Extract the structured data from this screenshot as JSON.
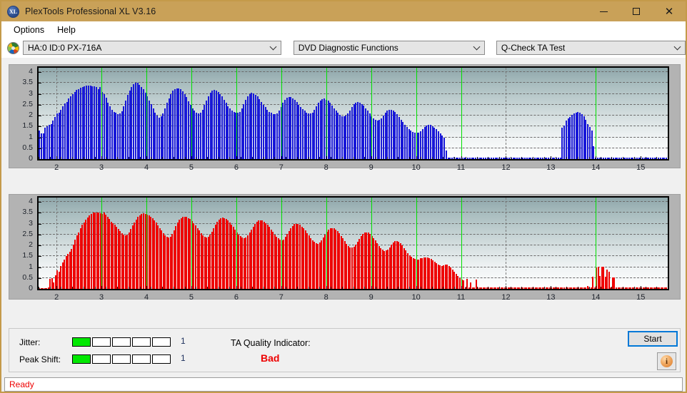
{
  "window": {
    "title": "PlexTools Professional XL V3.16",
    "icon": "XL",
    "minimize_label": "minimize",
    "maximize_label": "maximize",
    "close_label": "close"
  },
  "menu": {
    "items": [
      {
        "label": "Options"
      },
      {
        "label": "Help"
      }
    ]
  },
  "toolbar": {
    "drive": "HA:0 ID:0  PX-716A",
    "function": "DVD Diagnostic Functions",
    "test": "Q-Check TA Test"
  },
  "indicators": {
    "jitter_label": "Jitter:",
    "jitter_value": "1",
    "jitter_filled": 1,
    "jitter_segments": 5,
    "peakshift_label": "Peak Shift:",
    "peakshift_value": "1",
    "peakshift_filled": 1,
    "peakshift_segments": 5,
    "ta_label": "TA Quality Indicator:",
    "ta_value": "Bad",
    "ta_color": "#ee0000",
    "meter_on_color": "#00e800"
  },
  "buttons": {
    "start": "Start",
    "info": "i"
  },
  "status": {
    "text": "Ready"
  },
  "chart_data": [
    {
      "id": "ta-asymmetry-top",
      "type": "bar",
      "title": "",
      "xlabel": "",
      "ylabel": "",
      "color": "#1818d8",
      "ylim": [
        0,
        4.2
      ],
      "yticks": [
        0,
        0.5,
        1,
        1.5,
        2,
        2.5,
        3,
        3.5,
        4
      ],
      "ytick_labels": [
        "0",
        "0.5",
        "1",
        "1.5",
        "2",
        "2.5",
        "3",
        "3.5",
        "4"
      ],
      "xlim": [
        1.6,
        15.6
      ],
      "xticks": [
        2,
        3,
        4,
        5,
        6,
        7,
        8,
        9,
        10,
        11,
        12,
        13,
        14,
        15
      ],
      "xtick_labels": [
        "2",
        "3",
        "4",
        "5",
        "6",
        "7",
        "8",
        "9",
        "10",
        "11",
        "12",
        "13",
        "14",
        "15"
      ],
      "grid": true,
      "gridlines_v_dashed_at": [
        2,
        4,
        6,
        8,
        10,
        12,
        14
      ],
      "marker_lines_green_at": [
        3,
        4,
        5,
        6,
        7,
        8,
        9,
        10,
        11,
        14
      ],
      "marker_color": "#00e000",
      "values": [
        1.3,
        1.18,
        1.18,
        1.45,
        1.52,
        1.58,
        1.6,
        1.78,
        1.93,
        2.1,
        2.12,
        2.28,
        2.43,
        2.55,
        2.62,
        2.78,
        2.9,
        3.0,
        3.1,
        3.18,
        3.2,
        3.28,
        3.3,
        3.35,
        3.38,
        3.39,
        3.38,
        3.36,
        3.34,
        3.32,
        3.22,
        3.3,
        3.1,
        2.98,
        2.82,
        2.6,
        2.42,
        2.28,
        2.18,
        2.12,
        2.08,
        2.1,
        2.2,
        2.42,
        2.68,
        2.95,
        3.15,
        3.32,
        3.45,
        3.52,
        3.5,
        3.4,
        3.32,
        3.2,
        3.05,
        2.88,
        2.7,
        2.52,
        2.32,
        2.14,
        2.0,
        1.92,
        1.96,
        2.1,
        2.32,
        2.58,
        2.8,
        3.0,
        3.14,
        3.22,
        3.26,
        3.25,
        3.22,
        3.12,
        3.0,
        2.84,
        2.66,
        2.5,
        2.34,
        2.22,
        2.12,
        2.1,
        2.14,
        2.28,
        2.48,
        2.7,
        2.9,
        3.05,
        3.14,
        3.18,
        3.16,
        3.1,
        3.0,
        2.88,
        2.74,
        2.58,
        2.44,
        2.32,
        2.22,
        2.16,
        2.12,
        2.12,
        2.18,
        2.34,
        2.54,
        2.74,
        2.9,
        3.0,
        3.04,
        3.02,
        2.96,
        2.88,
        2.76,
        2.64,
        2.5,
        2.38,
        2.26,
        2.18,
        2.12,
        2.08,
        2.06,
        2.1,
        2.22,
        2.4,
        2.58,
        2.72,
        2.82,
        2.86,
        2.84,
        2.8,
        2.72,
        2.62,
        2.5,
        2.4,
        2.3,
        2.22,
        2.14,
        2.1,
        2.1,
        2.14,
        2.28,
        2.44,
        2.6,
        2.7,
        2.76,
        2.78,
        2.74,
        2.68,
        2.58,
        2.46,
        2.34,
        2.22,
        2.12,
        2.04,
        1.98,
        1.96,
        2.0,
        2.1,
        2.24,
        2.4,
        2.52,
        2.6,
        2.62,
        2.6,
        2.54,
        2.45,
        2.34,
        2.22,
        2.1,
        1.98,
        1.88,
        1.82,
        1.78,
        1.8,
        1.88,
        2.0,
        2.12,
        2.22,
        2.28,
        2.28,
        2.24,
        2.16,
        2.06,
        1.94,
        1.82,
        1.7,
        1.58,
        1.48,
        1.38,
        1.3,
        1.25,
        1.22,
        1.2,
        1.22,
        1.28,
        1.38,
        1.48,
        1.55,
        1.58,
        1.56,
        1.52,
        1.46,
        1.38,
        1.28,
        1.18,
        1.08,
        0.98,
        0.4,
        0.05,
        0.05,
        0.05,
        0.1,
        0.05,
        0.05,
        0.05,
        0.05,
        0.05,
        0.05,
        0.05,
        0.05,
        0.05,
        0.05,
        0.05,
        0.05,
        0.05,
        0.05,
        0.05,
        0.05,
        0.05,
        0.05,
        0.05,
        0.05,
        0.05,
        0.05,
        0.05,
        0.05,
        0.05,
        0.05,
        0.05,
        0.05,
        0.05,
        0.05,
        0.05,
        0.05,
        0.05,
        0.05,
        0.05,
        0.05,
        0.05,
        0.05,
        0.05,
        0.05,
        0.05,
        0.05,
        0.05,
        0.05,
        0.05,
        0.05,
        0.05,
        0.05,
        0.05,
        0.05,
        0.05,
        0.05,
        0.05,
        0.05,
        1.45,
        1.55,
        1.78,
        1.88,
        1.95,
        2.02,
        2.1,
        2.14,
        2.18,
        2.12,
        2.06,
        1.98,
        1.8,
        1.62,
        1.48,
        1.3,
        0.6,
        0.05,
        0.05,
        0.05,
        0.05,
        0.05,
        0.05,
        0.05,
        0.05,
        0.05,
        0.05,
        0.05,
        0.05,
        0.05,
        0.05,
        0.05,
        0.05,
        0.05,
        0.05,
        0.05,
        0.05,
        0.05,
        0.05,
        0.05,
        0.05,
        0.05,
        0.05,
        0.05,
        0.05,
        0.05,
        0.05,
        0.05,
        0.05,
        0.05,
        0.05,
        0.05,
        0.05,
        0.05
      ]
    },
    {
      "id": "ta-asymmetry-bottom",
      "type": "bar",
      "title": "",
      "xlabel": "",
      "ylabel": "",
      "color": "#ee0000",
      "ylim": [
        0,
        4.2
      ],
      "yticks": [
        0,
        0.5,
        1,
        1.5,
        2,
        2.5,
        3,
        3.5,
        4
      ],
      "ytick_labels": [
        "0",
        "0.5",
        "1",
        "1.5",
        "2",
        "2.5",
        "3",
        "3.5",
        "4"
      ],
      "xlim": [
        1.6,
        15.6
      ],
      "xticks": [
        2,
        3,
        4,
        5,
        6,
        7,
        8,
        9,
        10,
        11,
        12,
        13,
        14,
        15
      ],
      "xtick_labels": [
        "2",
        "3",
        "4",
        "5",
        "6",
        "7",
        "8",
        "9",
        "10",
        "11",
        "12",
        "13",
        "14",
        "15"
      ],
      "grid": true,
      "gridlines_v_dashed_at": [
        2,
        4,
        6,
        8,
        10,
        12,
        14
      ],
      "marker_lines_green_at": [
        3,
        4,
        5,
        6,
        7,
        8,
        9,
        10,
        11,
        14
      ],
      "marker_color": "#00e000",
      "values": [
        0.03,
        0.03,
        0.03,
        0.03,
        0.03,
        0.08,
        0.45,
        0.48,
        0.3,
        0.62,
        0.85,
        0.8,
        1.05,
        1.2,
        1.35,
        1.5,
        1.6,
        1.72,
        1.85,
        2.05,
        2.25,
        2.45,
        2.6,
        2.8,
        2.95,
        3.05,
        3.18,
        3.28,
        3.38,
        3.45,
        3.5,
        3.52,
        3.52,
        3.5,
        3.47,
        3.45,
        3.5,
        3.4,
        3.3,
        3.2,
        3.1,
        3.02,
        2.95,
        2.85,
        2.75,
        2.65,
        2.55,
        2.48,
        2.45,
        2.5,
        2.6,
        2.75,
        2.92,
        3.05,
        3.18,
        3.3,
        3.38,
        3.44,
        3.47,
        3.45,
        3.42,
        3.38,
        3.32,
        3.24,
        3.15,
        3.05,
        2.92,
        2.8,
        2.68,
        2.55,
        2.45,
        2.38,
        2.35,
        2.4,
        2.52,
        2.7,
        2.88,
        3.05,
        3.18,
        3.25,
        3.3,
        3.32,
        3.3,
        3.26,
        3.2,
        3.12,
        3.02,
        2.92,
        2.8,
        2.68,
        2.55,
        2.45,
        2.38,
        2.35,
        2.38,
        2.48,
        2.62,
        2.8,
        2.95,
        3.08,
        3.18,
        3.25,
        3.28,
        3.26,
        3.22,
        3.15,
        3.06,
        2.96,
        2.85,
        2.72,
        2.6,
        2.5,
        2.42,
        2.36,
        2.33,
        2.36,
        2.45,
        2.58,
        2.72,
        2.85,
        2.98,
        3.08,
        3.14,
        3.16,
        3.14,
        3.1,
        3.02,
        2.94,
        2.84,
        2.74,
        2.62,
        2.5,
        2.4,
        2.32,
        2.26,
        2.24,
        2.28,
        2.38,
        2.52,
        2.66,
        2.8,
        2.9,
        2.98,
        3.0,
        2.98,
        2.94,
        2.86,
        2.78,
        2.68,
        2.56,
        2.45,
        2.34,
        2.24,
        2.16,
        2.1,
        2.08,
        2.12,
        2.22,
        2.36,
        2.5,
        2.62,
        2.72,
        2.78,
        2.8,
        2.78,
        2.72,
        2.65,
        2.55,
        2.44,
        2.32,
        2.2,
        2.08,
        1.98,
        1.92,
        1.9,
        1.94,
        2.04,
        2.16,
        2.3,
        2.42,
        2.52,
        2.58,
        2.6,
        2.58,
        2.52,
        2.44,
        2.34,
        2.22,
        2.1,
        1.98,
        1.88,
        1.8,
        1.75,
        1.76,
        1.82,
        1.92,
        2.04,
        2.14,
        2.2,
        2.2,
        2.16,
        2.1,
        2.0,
        1.88,
        1.76,
        1.65,
        1.55,
        1.48,
        1.42,
        1.38,
        1.36,
        1.36,
        1.4,
        1.42,
        1.44,
        1.45,
        1.44,
        1.42,
        1.38,
        1.32,
        1.25,
        1.18,
        1.12,
        1.08,
        1.05,
        1.08,
        1.12,
        1.1,
        1.05,
        0.98,
        0.9,
        0.8,
        0.7,
        0.6,
        0.5,
        0.42,
        0.38,
        0.05,
        0.45,
        0.05,
        0.28,
        0.05,
        0.05,
        0.42,
        0.05,
        0.05,
        0.05,
        0.05,
        0.05,
        0.05,
        0.05,
        0.05,
        0.05,
        0.05,
        0.05,
        0.05,
        0.05,
        0.05,
        0.05,
        0.05,
        0.05,
        0.05,
        0.05,
        0.05,
        0.05,
        0.05,
        0.05,
        0.05,
        0.05,
        0.05,
        0.05,
        0.05,
        0.05,
        0.05,
        0.05,
        0.05,
        0.05,
        0.05,
        0.05,
        0.05,
        0.05,
        0.05,
        0.05,
        0.05,
        0.05,
        0.05,
        0.05,
        0.05,
        0.05,
        0.05,
        0.05,
        0.05,
        0.05,
        0.05,
        0.05,
        0.05,
        0.05,
        0.05,
        0.05,
        0.05,
        0.05,
        0.05,
        0.05,
        0.05,
        0.05,
        0.12,
        0.05,
        0.05,
        0.55,
        0.05,
        0.98,
        1.02,
        0.6,
        1.02,
        1.02,
        0.55,
        0.9,
        0.8,
        0.05,
        0.52,
        0.52,
        0.05,
        0.05,
        0.05,
        0.05,
        0.05,
        0.05,
        0.05,
        0.05,
        0.05,
        0.05,
        0.05,
        0.05,
        0.05,
        0.05,
        0.05,
        0.05,
        0.05,
        0.05,
        0.05,
        0.05,
        0.05,
        0.05,
        0.05,
        0.05,
        0.05,
        0.05,
        0.05,
        0.05,
        0.05
      ]
    }
  ]
}
